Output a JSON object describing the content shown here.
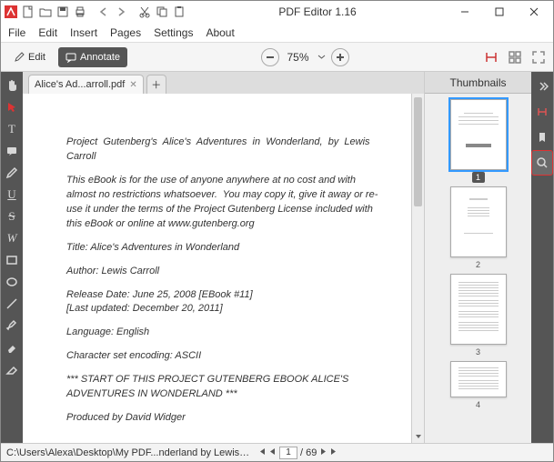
{
  "app": {
    "title": "PDF Editor 1.16"
  },
  "menu": {
    "file": "File",
    "edit": "Edit",
    "insert": "Insert",
    "pages": "Pages",
    "settings": "Settings",
    "about": "About"
  },
  "modes": {
    "edit": "Edit",
    "annotate": "Annotate"
  },
  "zoom": {
    "value": "75%"
  },
  "tab": {
    "name": "Alice's Ad...arroll.pdf"
  },
  "doc": {
    "l1": "Project  Gutenberg's  Alice's  Adventures  in  Wonderland,  by  Lewis Carroll",
    "l2": "This eBook is for the use of anyone anywhere at no cost and with almost no restrictions whatsoever.  You may copy it, give it away or re-use it under the terms of the Project Gutenberg License included with this eBook or online at www.gutenberg.org",
    "l3": "Title: Alice's Adventures in Wonderland",
    "l4": "Author: Lewis Carroll",
    "l5": "Release Date: June 25, 2008 [EBook #11]\n[Last updated: December 20, 2011]",
    "l6": "Language: English",
    "l7": "Character set encoding: ASCII",
    "l8": "*** START OF THIS PROJECT GUTENBERG EBOOK ALICE'S ADVENTURES IN WONDERLAND ***",
    "l9": "Produced by David Widger"
  },
  "thumbs": {
    "title": "Thumbnails",
    "n1": "1",
    "n2": "2",
    "n3": "3",
    "n4": "4"
  },
  "status": {
    "path": "C:\\Users\\Alexa\\Desktop\\My PDF...nderland by Lewis Carroll.pdf",
    "page": "1",
    "total": "/ 69"
  }
}
